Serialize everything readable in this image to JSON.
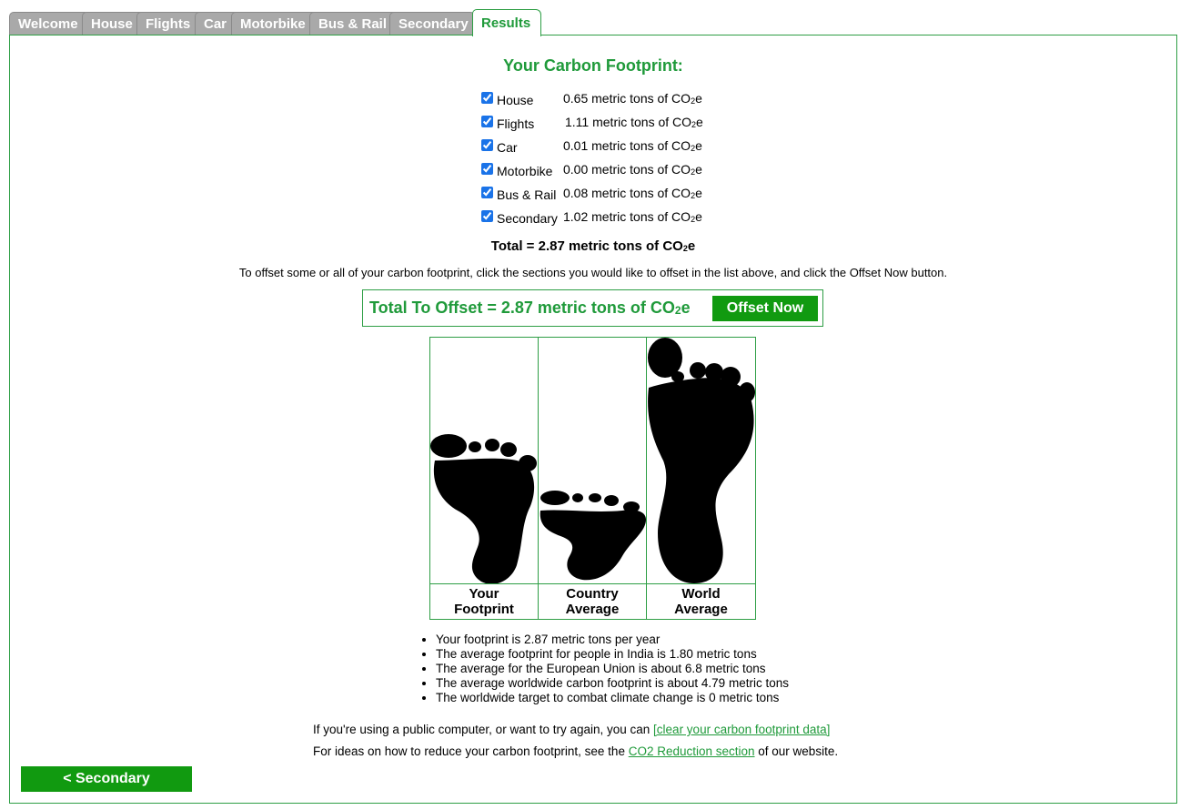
{
  "tabs": [
    {
      "label": "Welcome",
      "active": false
    },
    {
      "label": "House",
      "active": false
    },
    {
      "label": "Flights",
      "active": false
    },
    {
      "label": "Car",
      "active": false
    },
    {
      "label": "Motorbike",
      "active": false
    },
    {
      "label": "Bus & Rail",
      "active": false
    },
    {
      "label": "Secondary",
      "active": false
    },
    {
      "label": "Results",
      "active": true
    }
  ],
  "results": {
    "title": "Your Carbon Footprint:",
    "unit_prefix": "metric tons of CO",
    "unit_sub": "2",
    "unit_suffix": "e",
    "items": [
      {
        "label": "House",
        "value": "0.65",
        "checked": true
      },
      {
        "label": "Flights",
        "value": "1.11",
        "checked": true
      },
      {
        "label": "Car",
        "value": "0.01",
        "checked": true
      },
      {
        "label": "Motorbike",
        "value": "0.00",
        "checked": true
      },
      {
        "label": "Bus & Rail",
        "value": "0.08",
        "checked": true
      },
      {
        "label": "Secondary",
        "value": "1.02",
        "checked": true
      }
    ],
    "total_prefix": "Total = 2.87 metric tons of CO",
    "instructions": "To offset some or all of your carbon footprint, click the sections you would like to offset in the list above, and click the Offset Now button.",
    "offset_prefix": "Total To Offset = 2.87 metric tons of CO",
    "offset_button": "Offset Now"
  },
  "footprints": {
    "your_footprint": 2.87,
    "country_average": 1.8,
    "world_average": 4.79,
    "captions": [
      {
        "line1": "Your",
        "line2": "Footprint"
      },
      {
        "line1": "Country",
        "line2": "Average"
      },
      {
        "line1": "World",
        "line2": "Average"
      }
    ]
  },
  "facts": [
    "Your footprint is 2.87 metric tons per year",
    "The average footprint for people in India is 1.80 metric tons",
    "The average for the European Union is about 6.8 metric tons",
    "The average worldwide carbon footprint is about 4.79 metric tons",
    "The worldwide target to combat climate change is 0 metric tons"
  ],
  "footer": {
    "line1_text": "If you're using a public computer, or want to try again, you can ",
    "line1_link": "[clear your carbon footprint data]",
    "line2_text": "For ideas on how to reduce your carbon footprint, see the ",
    "line2_link": "CO2 Reduction section",
    "line2_after": " of our website.",
    "back_button": "< Secondary"
  }
}
